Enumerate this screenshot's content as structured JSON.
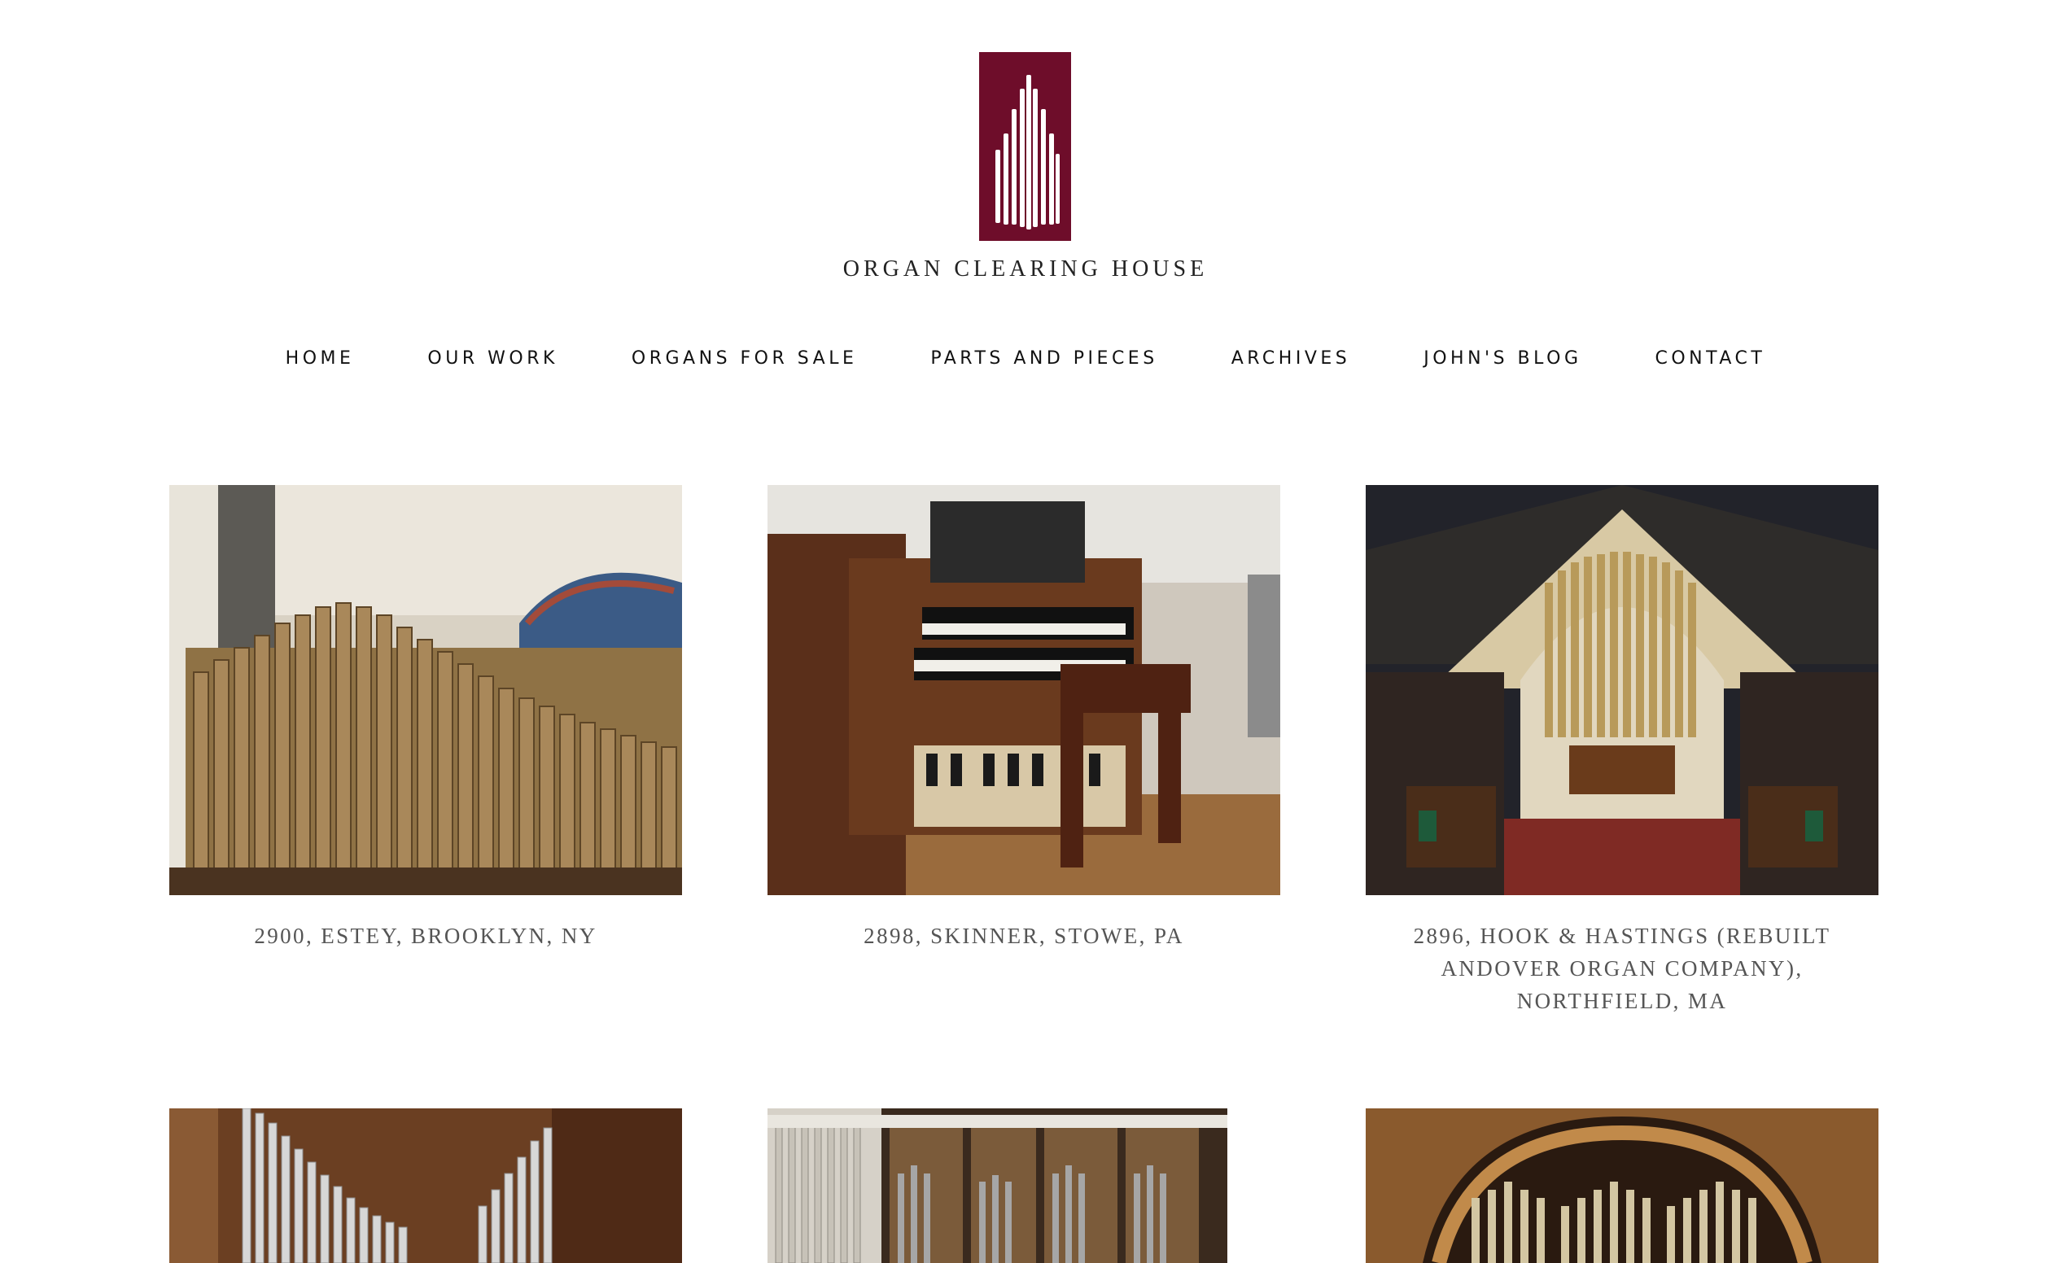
{
  "site": {
    "logo_text": "Organ Clearing House",
    "brand_color": "#6e0d2a"
  },
  "nav": {
    "items": [
      {
        "label": "Home"
      },
      {
        "label": "Our Work"
      },
      {
        "label": "Organs for Sale"
      },
      {
        "label": "Parts and Pieces"
      },
      {
        "label": "Archives"
      },
      {
        "label": "John's Blog"
      },
      {
        "label": "Contact"
      }
    ]
  },
  "gallery": {
    "items": [
      {
        "caption": "2900, Estey, Brooklyn, NY",
        "image": "organ-pipes-photo"
      },
      {
        "caption": "2898, Skinner, Stowe, PA",
        "image": "organ-console-photo"
      },
      {
        "caption": "2896, Hook & Hastings (Rebuilt Andover Organ Company), Northfield, MA",
        "image": "church-organ-photo"
      },
      {
        "caption": "",
        "image": "organ-pipes-wood-case-photo"
      },
      {
        "caption": "",
        "image": "organ-facade-carved-photo"
      },
      {
        "caption": "",
        "image": "arched-organ-photo"
      }
    ]
  }
}
